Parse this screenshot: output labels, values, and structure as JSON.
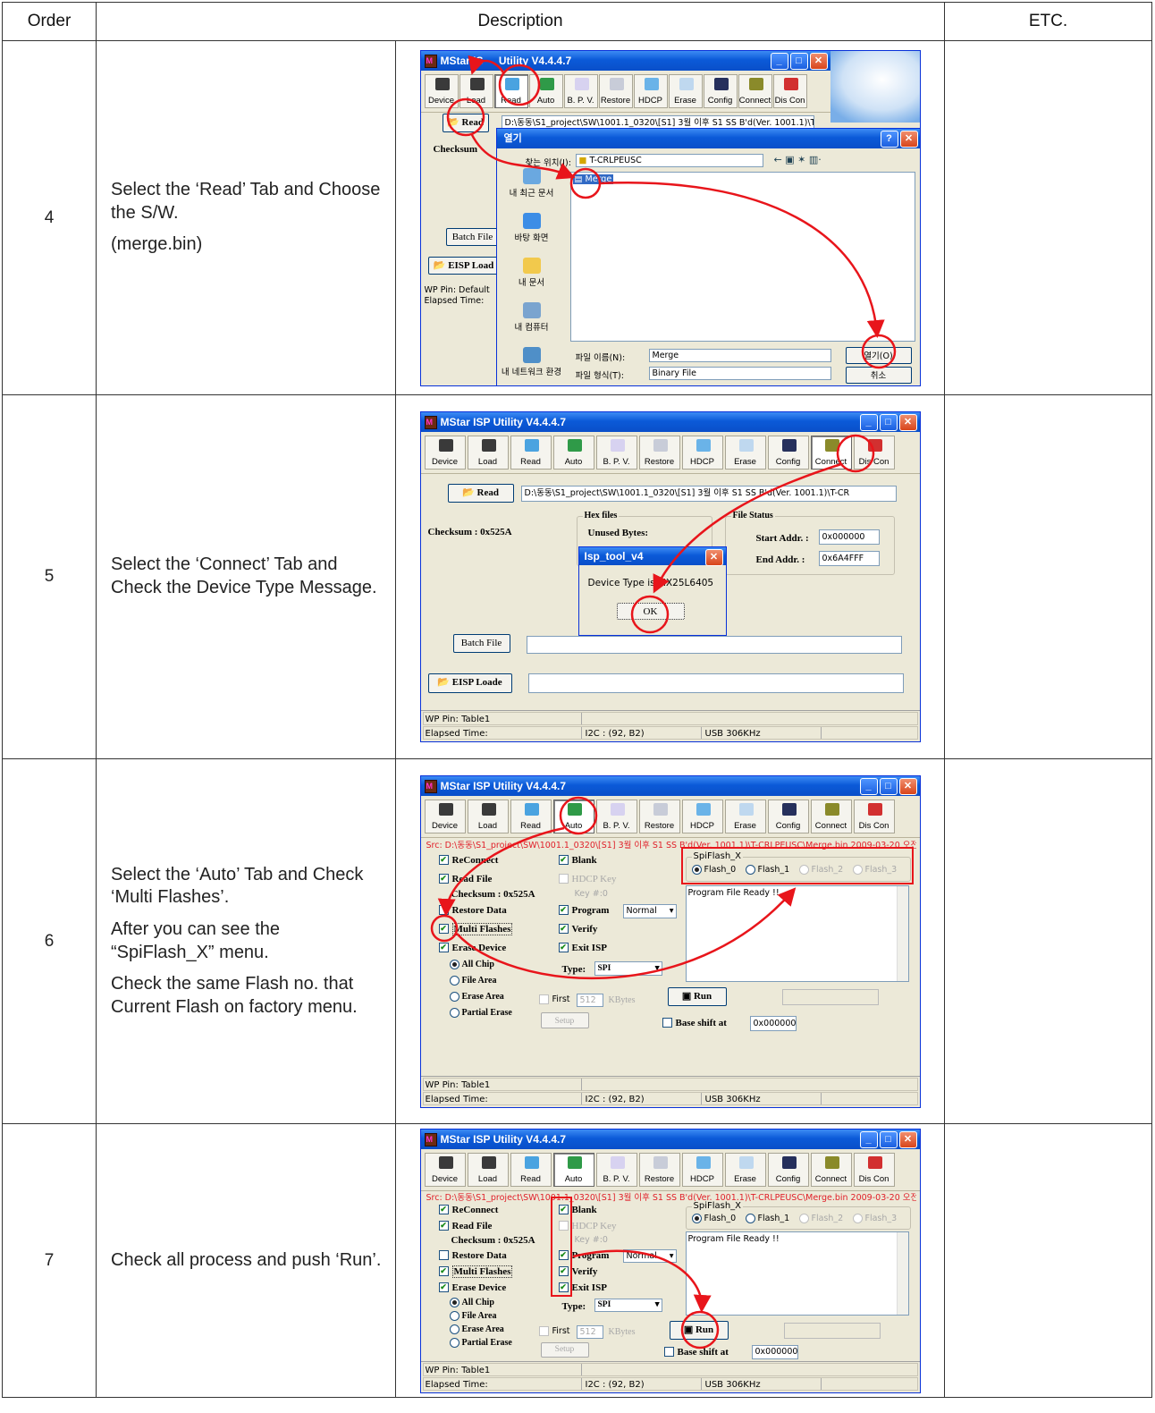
{
  "table": {
    "headers": {
      "order": "Order",
      "description": "Description",
      "etc": "ETC."
    }
  },
  "rows": [
    {
      "order": "4",
      "desc": [
        "Select the ‘Read’ Tab and Choose the S/W.",
        "(merge.bin)"
      ]
    },
    {
      "order": "5",
      "desc": [
        "Select the ‘Connect’ Tab and Check the Device Type Message."
      ]
    },
    {
      "order": "6",
      "desc": [
        "Select the ‘Auto’ Tab and Check ‘Multi Flashes’.",
        "After you can see the “SpiFlash_X” menu.",
        "Check the same Flash no. that Current Flash on factory menu."
      ]
    },
    {
      "order": "7",
      "desc": [
        "Check all process and push ‘Run’."
      ]
    }
  ],
  "app": {
    "title_short": "MStar IS",
    "title": "MStar ISP Utility V4.4.4.7",
    "title_suffix": "Utility V4.4.4.7",
    "tools": [
      "Device",
      "Load",
      "Read",
      "Auto",
      "B. P. V.",
      "Restore",
      "HDCP",
      "Erase",
      "Config",
      "Connect",
      "Dis Con"
    ],
    "read_button": "Read",
    "path": "D:\\동동\\S1_project\\SW\\1001.1_0320\\[S1] 3월 이후 S1 SS B'd(Ver. 1001.1)\\T-CR",
    "path_short": "D:\\동동\\S1_project\\SW\\1001.1_0320\\[S1] 3월 이후 S1 SS B'd(Ver. 1001.1)\\T-CR",
    "checksum_label": "Checksum",
    "checksum": "Checksum : 0x525A",
    "checksum_auto": "Checksum : 0x525A",
    "batch_file": "Batch File",
    "eisp_load": "EISP Load",
    "eisp_loader": "EISP Loade",
    "wp_pin_default": "WP Pin: Default",
    "wp_pin_table": "WP Pin: Table1",
    "elapsed": "Elapsed Time:",
    "i2c": "I2C : (92, B2)",
    "usb": "USB  306KHz",
    "hex_files": "Hex files",
    "unused_bytes": "Unused Bytes:",
    "file_status": "File Status",
    "start_addr_label": "Start Addr. :",
    "start_addr": "0x000000",
    "end_addr_label": "End Addr. :",
    "end_addr": "0x6A4FFF"
  },
  "open_dialog": {
    "title": "열기",
    "look_in_label": "찾는 위치(I):",
    "look_in": "T-CRLPEUSC",
    "places": [
      "내 최근 문서",
      "바탕 화면",
      "내 문서",
      "내 컴퓨터",
      "내 네트워크 환경"
    ],
    "file_item": "Merge",
    "filename_label": "파일 이름(N):",
    "filename": "Merge",
    "filetype_label": "파일 형식(T):",
    "filetype": "Binary File",
    "open_button": "열기(O)",
    "cancel_button": "취소"
  },
  "device_popup": {
    "title": "Isp_tool_v4",
    "message": "Device Type is MX25L6405",
    "ok": "OK"
  },
  "auto_tab": {
    "src": "Src: D:\\동동\\S1_project\\SW\\1001.1_0320\\[S1] 3월 이후 S1 SS B'd(Ver. 1001.1)\\T-CRLPEUSC\\Merge.bin 2009-03-20 오전",
    "reconnect": "ReConnect",
    "read_file": "Read File",
    "restore_data": "Restore Data",
    "multi_flashes": "Multi Flashes",
    "erase_device": "Erase Device",
    "all_chip": "All Chip",
    "file_area": "File Area",
    "erase_area": "Erase Area",
    "partial_erase": "Partial Erase",
    "blank": "Blank",
    "hdcp_key": "HDCP Key",
    "key_no": "Key #:0",
    "program": "Program",
    "program_mode": "Normal",
    "verify": "Verify",
    "exit_isp": "Exit ISP",
    "type_label": "Type:",
    "type_value": "SPI",
    "first": "First",
    "first_value": "512",
    "kbytes": "KBytes",
    "setup": "Setup",
    "run": "Run",
    "base_shift": "Base shift at",
    "base_shift_value": "0x000000",
    "spiflash_group": "SpiFlash_X",
    "flashes": [
      "Flash_0",
      "Flash_1",
      "Flash_2",
      "Flash_3"
    ],
    "log": "Program File Ready !!"
  },
  "colors": {
    "annotation": "#e8151b",
    "title_bar": "#0a54d2",
    "window_bg": "#ece9d8"
  }
}
